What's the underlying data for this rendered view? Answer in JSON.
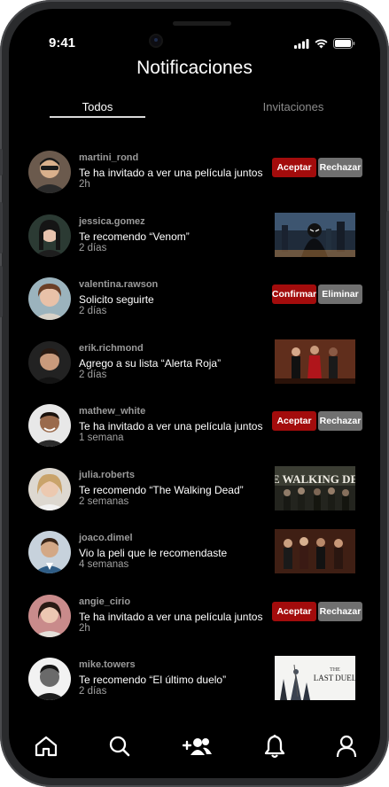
{
  "status_bar": {
    "time": "9:41"
  },
  "header": {
    "title": "Notificaciones"
  },
  "tabs": [
    {
      "label": "Todos"
    },
    {
      "label": "Invitaciones"
    }
  ],
  "notifications": [
    {
      "user": "martini_rond",
      "message": "Te ha invitado a ver una película juntos",
      "time": "2h",
      "primary_action": "Aceptar",
      "secondary_action": "Rechazar"
    },
    {
      "user": "jessica.gomez",
      "message": "Te recomendo “Venom”",
      "time": "2 días",
      "thumbnail": "venom-poster"
    },
    {
      "user": "valentina.rawson",
      "message": "Solicito seguirte",
      "time": "2 días",
      "primary_action": "Confirmar",
      "secondary_action": "Eliminar"
    },
    {
      "user": "erik.richmond",
      "message": "Agrego a su lista “Alerta Roja”",
      "time": "2 días",
      "thumbnail": "alerta-roja-poster"
    },
    {
      "user": "mathew_white",
      "message": "Te ha invitado a ver una película juntos",
      "time": "1 semana",
      "primary_action": "Aceptar",
      "secondary_action": "Rechazar"
    },
    {
      "user": "julia.roberts",
      "message": "Te recomendo “The Walking Dead”",
      "time": "2 semanas",
      "thumbnail": "walking-dead-poster",
      "thumbnail_text": "THE WALKING DEAD"
    },
    {
      "user": "joaco.dimel",
      "message": "Vio la peli que le recomendaste",
      "time": "4 semanas",
      "thumbnail": "movie-poster"
    },
    {
      "user": "angie_cirio",
      "message": "Te ha invitado a ver una película juntos",
      "time": "2h",
      "primary_action": "Aceptar",
      "secondary_action": "Rechazar"
    },
    {
      "user": "mike.towers",
      "message": "Te recomendo “El último duelo”",
      "time": "2 días",
      "thumbnail": "last-duel-poster",
      "thumbnail_text_small": "THE",
      "thumbnail_text": "LAST DUEL"
    }
  ],
  "nav": [
    {
      "icon": "home-icon"
    },
    {
      "icon": "search-icon"
    },
    {
      "icon": "add-friend-icon"
    },
    {
      "icon": "bell-icon",
      "active": true
    },
    {
      "icon": "profile-icon"
    }
  ],
  "colors": {
    "accent_red": "#a30c0c",
    "button_gray": "#707070",
    "background": "#000000"
  }
}
